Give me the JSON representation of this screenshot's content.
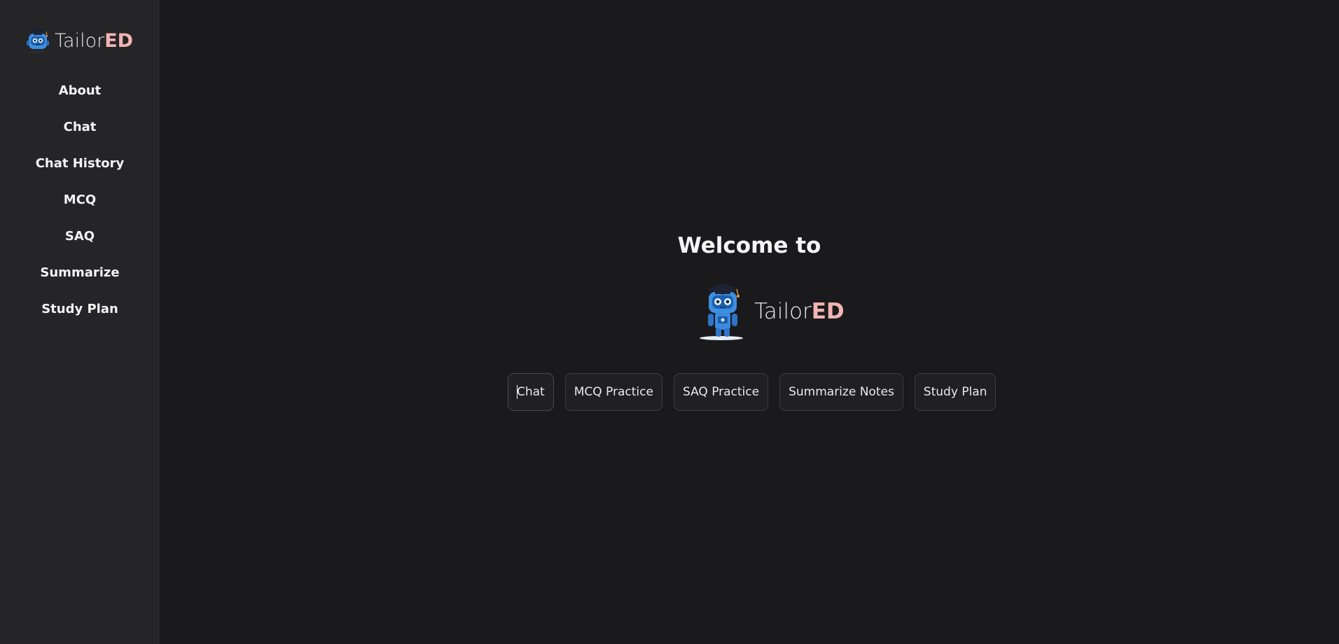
{
  "brand": {
    "name_light": "Tailor",
    "name_accent": "ED",
    "accent_color": "#f3b4b4"
  },
  "sidebar": {
    "items": [
      {
        "label": "About"
      },
      {
        "label": "Chat"
      },
      {
        "label": "Chat History"
      },
      {
        "label": "MCQ"
      },
      {
        "label": "SAQ"
      },
      {
        "label": "Summarize"
      },
      {
        "label": "Study Plan"
      }
    ]
  },
  "main": {
    "welcome": "Welcome to",
    "actions": [
      {
        "label": "Chat"
      },
      {
        "label": "MCQ Practice"
      },
      {
        "label": "SAQ Practice"
      },
      {
        "label": "Summarize Notes"
      },
      {
        "label": "Study Plan"
      }
    ]
  },
  "icons": {
    "logo": "robot-graduate-icon"
  }
}
